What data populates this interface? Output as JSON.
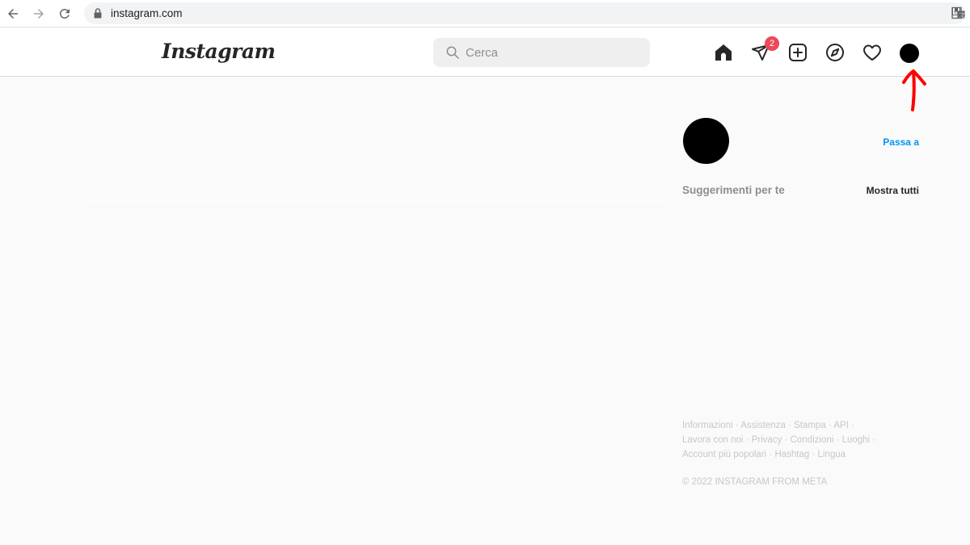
{
  "browser": {
    "url": "instagram.com"
  },
  "header": {
    "logo_text": "Instagram",
    "search_placeholder": "Cerca",
    "messages_badge": "2"
  },
  "sidebar": {
    "switch_label": "Passa a",
    "suggestions_title": "Suggerimenti per te",
    "show_all_label": "Mostra tutti"
  },
  "footer": {
    "links": [
      "Informazioni",
      "Assistenza",
      "Stampa",
      "API",
      "Lavora con noi",
      "Privacy",
      "Condizioni",
      "Luoghi",
      "Account più popolari",
      "Hashtag",
      "Lingua"
    ],
    "copyright": "© 2022 INSTAGRAM FROM META"
  },
  "colors": {
    "accent_link": "#0095f6",
    "badge": "#ed4956",
    "annotation_arrow": "#ff0000"
  }
}
